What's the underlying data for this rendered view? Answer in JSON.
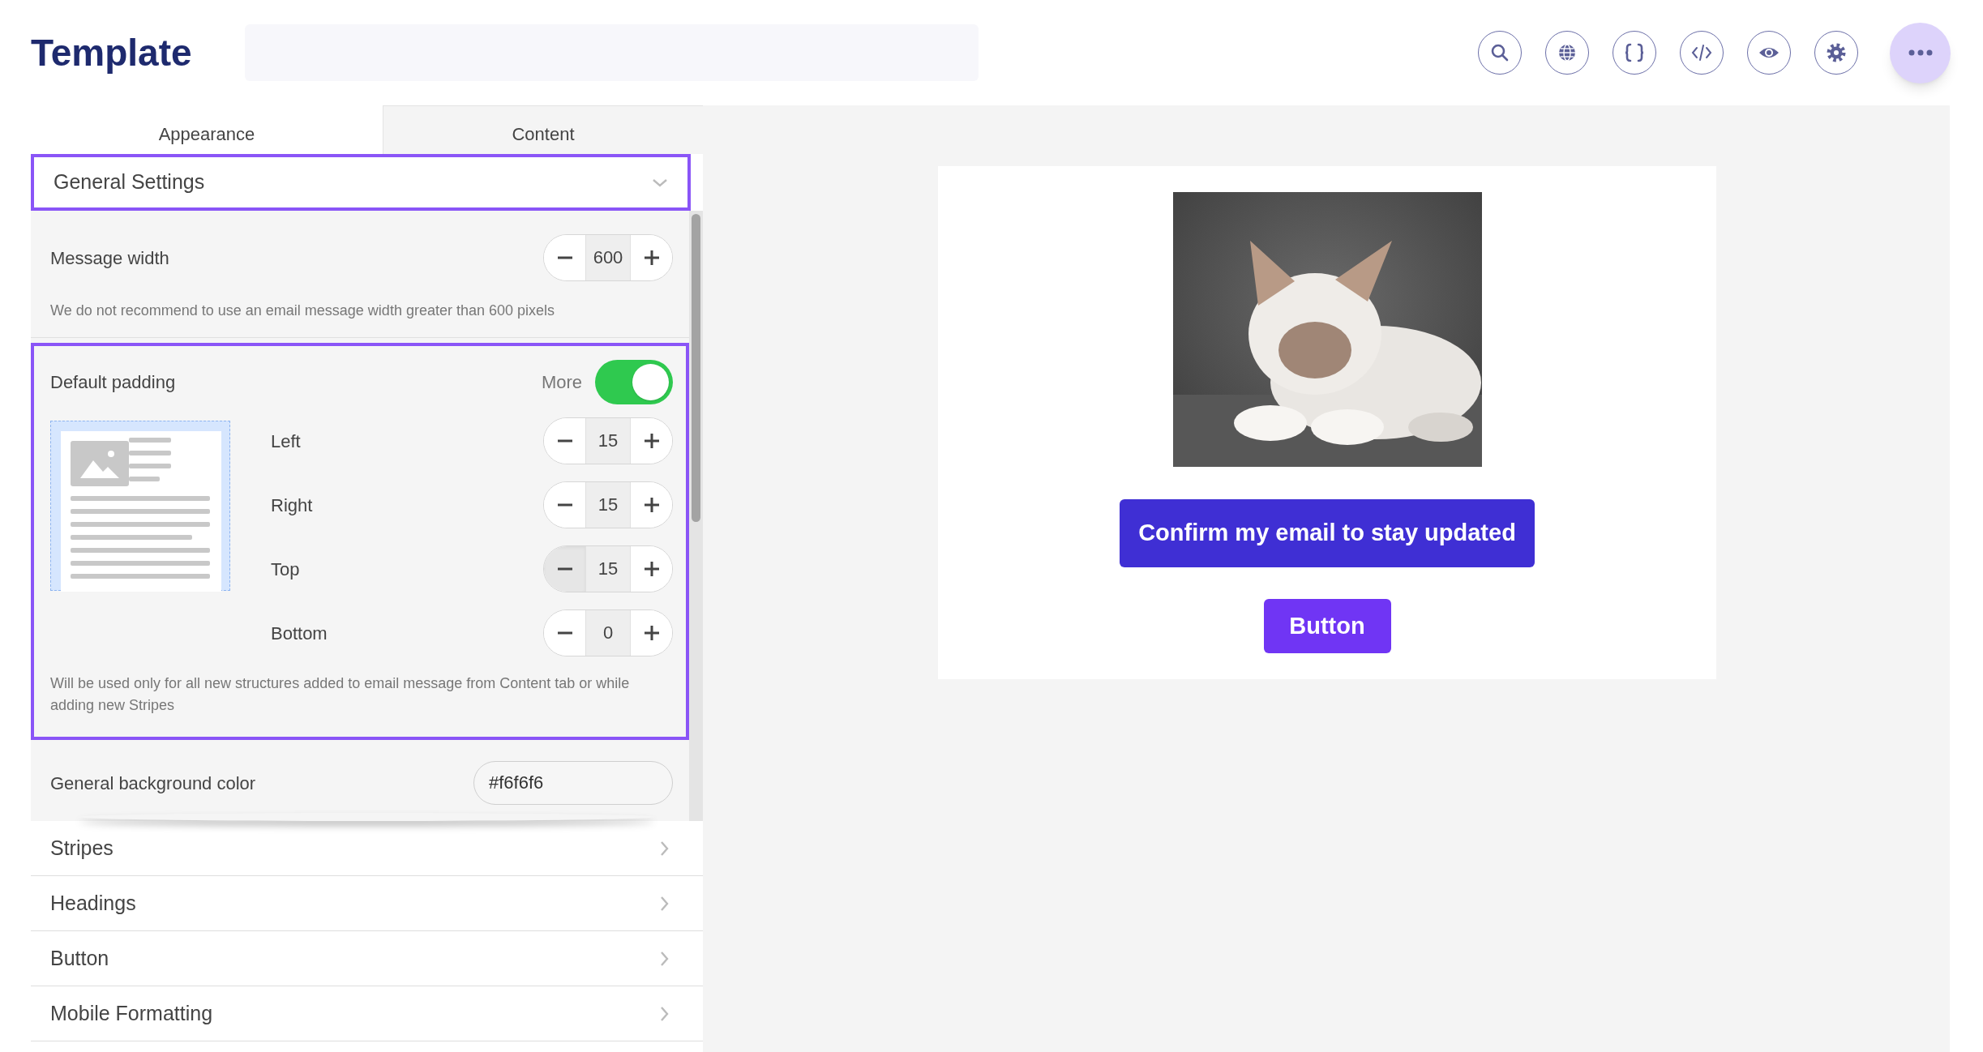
{
  "header": {
    "title": "Template",
    "toolbar": [
      {
        "kind": "search"
      },
      {
        "kind": "globe"
      },
      {
        "kind": "braces"
      },
      {
        "kind": "code"
      },
      {
        "kind": "eye"
      },
      {
        "kind": "gear"
      },
      {
        "kind": "more"
      }
    ]
  },
  "tabs": [
    {
      "label": "Appearance",
      "selected": true
    },
    {
      "label": "Content",
      "selected": false
    }
  ],
  "general_settings": {
    "title": "General Settings",
    "expanded": true,
    "highlighted": true,
    "message_width": {
      "label": "Message width",
      "value": "600",
      "note": "We do not recommend to use an email message width greater than 600 pixels"
    },
    "default_padding": {
      "label": "Default padding",
      "highlighted": true,
      "more_label": "More",
      "more_on": true,
      "fields": [
        {
          "label": "Left",
          "value": "15",
          "minus_pressed": false
        },
        {
          "label": "Right",
          "value": "15",
          "minus_pressed": false
        },
        {
          "label": "Top",
          "value": "15",
          "minus_pressed": true
        },
        {
          "label": "Bottom",
          "value": "0",
          "minus_pressed": false
        }
      ],
      "note": "Will be used only for all new structures added to email message from Content tab or while adding new Stripes"
    },
    "background_color": {
      "label": "General background color",
      "value": "#f6f6f6"
    }
  },
  "sections": [
    {
      "title": "Stripes",
      "expanded": false
    },
    {
      "title": "Headings",
      "expanded": false
    },
    {
      "title": "Button",
      "expanded": false
    },
    {
      "title": "Mobile Formatting",
      "expanded": false
    }
  ],
  "preview": {
    "buttons": [
      {
        "label": "Confirm my email to stay updated",
        "kind": "primary"
      },
      {
        "label": "Button",
        "kind": "secondary"
      }
    ]
  }
}
